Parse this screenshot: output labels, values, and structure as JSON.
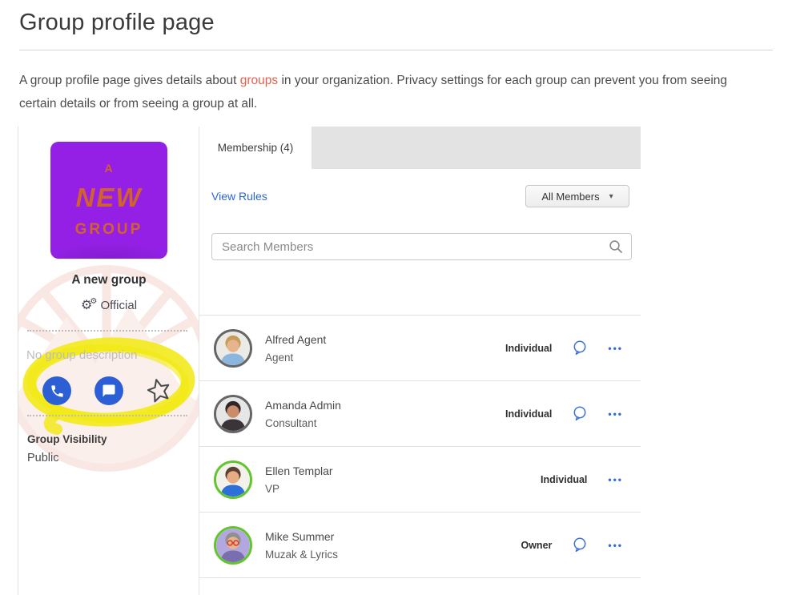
{
  "page": {
    "title": "Group profile page",
    "intro_before_link": "A group profile page gives details about ",
    "intro_link": "groups",
    "intro_after_link": " in your organization. Privacy settings for each group can prevent you from seeing certain details or from seeing a group at all."
  },
  "profile": {
    "avatar_lines": {
      "line1": "A",
      "line2": "NEW",
      "line3": "GROUP"
    },
    "name": "A new group",
    "badge": "Official",
    "no_description": "No group description",
    "visibility_label": "Group Visibility",
    "visibility_value": "Public"
  },
  "membership": {
    "tab_label": "Membership (4)",
    "view_rules": "View Rules",
    "filter_button": "All Members",
    "search_placeholder": "Search Members",
    "members": [
      {
        "name": "Alfred Agent",
        "title": "Agent",
        "role": "Individual",
        "has_chat": true,
        "avatar": {
          "ring": "#666666",
          "bg": "#eceae4",
          "hair": "#c79b5a",
          "skin": "#e6b58d",
          "shirt": "#8cb6de",
          "glasses": null
        }
      },
      {
        "name": "Amanda Admin",
        "title": "Consultant",
        "role": "Individual",
        "has_chat": true,
        "avatar": {
          "ring": "#666666",
          "bg": "#e6e6e6",
          "hair": "#2e2629",
          "skin": "#c98e69",
          "shirt": "#3a3438",
          "glasses": null
        }
      },
      {
        "name": "Ellen Templar",
        "title": "VP",
        "role": "Individual",
        "has_chat": false,
        "avatar": {
          "ring": "#62c52e",
          "bg": "#f2f1ec",
          "hair": "#5d4030",
          "skin": "#e6ad85",
          "shirt": "#2f6fd8",
          "glasses": null
        }
      },
      {
        "name": "Mike Summer",
        "title": "Muzak & Lyrics",
        "role": "Owner",
        "has_chat": true,
        "avatar": {
          "ring": "#62c52e",
          "bg": "#b3a7e0",
          "hair": "#8f8f8f",
          "skin": "#e6b58d",
          "shirt": "#7a6fae",
          "glasses": "#d43a2f"
        }
      }
    ]
  },
  "icons": {
    "gear_glyph": "⚙",
    "caret_glyph": "▾",
    "dots_glyph": "•••"
  },
  "colors": {
    "link_red": "#e8604c",
    "action_blue": "#2a66d9",
    "circle_button_blue": "#2b5fd3",
    "avatar_purple": "#9320e4",
    "avatar_text_orange": "#d2622d",
    "highlight_yellow": "#f2e90f",
    "tab_gray": "#e3e3e3",
    "ring_gray": "#666666",
    "ring_green": "#62c52e",
    "watermark_pink": "#f3d4cd"
  }
}
